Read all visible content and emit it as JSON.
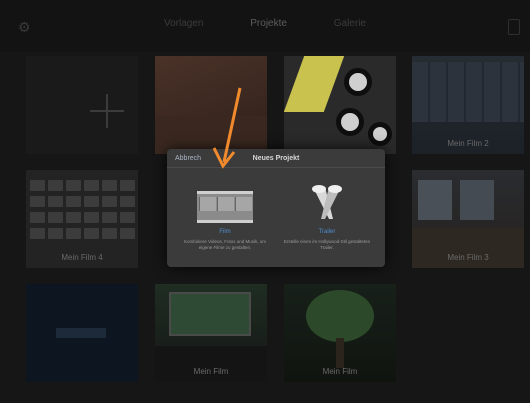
{
  "topbar": {
    "tabs": [
      "Vorlagen",
      "Projekte",
      "Galerie"
    ]
  },
  "tiles": {
    "add": {
      "label": ""
    },
    "items": [
      {
        "label": ""
      },
      {
        "label": ""
      },
      {
        "label": "Mein Film 2"
      },
      {
        "label": "Mein Film 4"
      },
      {
        "label": "Mein Film 3"
      },
      {
        "label": ""
      },
      {
        "label": "Mein Film"
      },
      {
        "label": "Mein Film"
      }
    ]
  },
  "dialog": {
    "back_label": "Abbrech",
    "title": "Neues Projekt",
    "choices": [
      {
        "name": "Film",
        "description": "Kombiniere Videos, Fotos und Musik, um eigene Filme zu gestalten."
      },
      {
        "name": "Trailer",
        "description": "Erstelle einen im Hollywood-Stil gestalteten Trailer."
      }
    ]
  },
  "annotation": {
    "arrow_color": "#f08a2d"
  },
  "colors": {
    "accent": "#4e8ed2",
    "background": "#161616",
    "dialog": "#3b3b3b"
  }
}
